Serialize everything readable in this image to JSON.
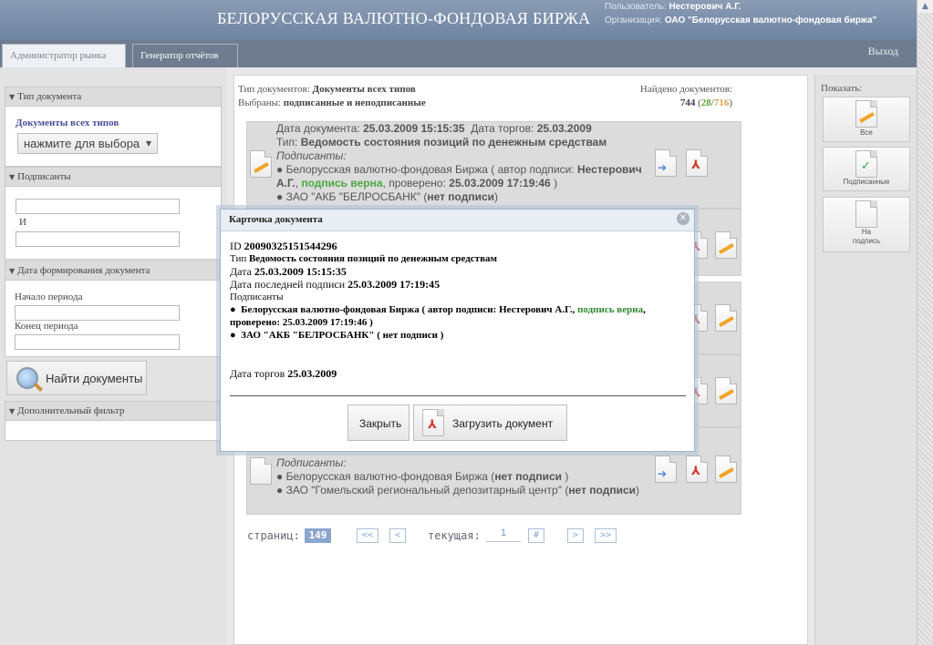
{
  "header": {
    "title": "БЕЛОРУССКАЯ ВАЛЮТНО-ФОНДОВАЯ БИРЖА",
    "user_label": "Пользователь:",
    "user_name": "Нестерович А.Г.",
    "org_label": "Организация:",
    "org_name": "ОАО \"Белорусская валютно-фондовая биржа\""
  },
  "tabs": [
    {
      "label": "Администратор рынка"
    },
    {
      "label": "Генератор отчётов"
    }
  ],
  "logout_label": "Выход",
  "sidebar": {
    "doctype_header": "Тип документа",
    "doctype_value": "Документы всех типов",
    "select_button": "нажмите для выбора",
    "signers_header": "Подписанты",
    "and_label": "И",
    "date_header": "Дата формирования документа",
    "period_start": "Начало периода",
    "period_end": "Конец периода",
    "find_button": "Найти документы",
    "extra_filter_header": "Дополнительный фильтр"
  },
  "filter": {
    "types_label": "Тип документов:",
    "types_value": "Документы всех типов",
    "selected_label": "Выбраны:",
    "selected_value": "подписанные и неподписанные",
    "found_label": "Найдено документов:",
    "found_total": "744",
    "found_signed": "28",
    "found_unsigned": "716",
    "open_paren": "(",
    "slash": "/",
    "close_paren": ")"
  },
  "doc1": {
    "date_label": "Дата документа:",
    "date_value": "25.03.2009 15:15:35",
    "trade_label": "Дата торгов:",
    "trade_value": "25.03.2009",
    "type_label": "Тип:",
    "type_value": "Ведомость состояния позиций по денежным средствам",
    "signers_label": "Подписанты:",
    "signer1_pre": "Белорусская валютно-фондовая Биржа ( автор подписи:",
    "signer1_author": "Нестерович А.Г.",
    "signer1_sep": ",",
    "signer1_status": "подпись верна",
    "signer1_checked": ", проверено:",
    "signer1_time": "25.03.2009 17:19:46",
    "signer1_close": ")",
    "signer2_pre": "ЗАО \"АКБ \"БЕЛРОСБАНК\" (",
    "signer2_status": "нет подписи",
    "signer2_close": ")"
  },
  "doc5": {
    "signers_label": "Подписанты:",
    "signer1_pre": "Белорусская валютно-фондовая Биржа (",
    "signer1_status": "нет подписи",
    "signer1_close": ")",
    "signer2_pre": "ЗАО \"Гомельский региональный депозитарный центр\" (",
    "signer2_status": "нет подписи",
    "signer2_close": ")"
  },
  "pager": {
    "pages_label": "страниц:",
    "total_pages": "149",
    "first": "<<",
    "prev": "<",
    "current_label": "текущая:",
    "current_value": "1",
    "go": "#",
    "next": ">",
    "last": ">>"
  },
  "right_panel": {
    "show_label": "Показать:",
    "all": "Все",
    "signed": "Подписанные",
    "to_sign_line1": "На",
    "to_sign_line2": "подпись"
  },
  "modal": {
    "title": "Карточка документа",
    "id_label": "ID",
    "id_value": "20090325151544296",
    "type_label": "Тип",
    "type_value": "Ведомость состояния позиций по денежным средствам",
    "date_label": "Дата",
    "date_value": "25.03.2009 15:15:35",
    "last_sign_label": "Дата последней подписи",
    "last_sign_value": "25.03.2009 17:19:45",
    "signers_label": "Подписанты",
    "bullet": "●",
    "signer1_pre": "Белорусская валютно-фондовая Биржа ( автор подписи: Нестерович А.Г.,",
    "signer1_status": "подпись верна",
    "signer1_post": ", проверено: 25.03.2009 17:19:46 )",
    "signer2": "ЗАО \"АКБ \"БЕЛРОСБАНК\" ( нет подписи )",
    "trade_label": "Дата торгов",
    "trade_value": "25.03.2009",
    "close_button": "Закрыть",
    "download_button": "Загрузить документ",
    "close_x": "✕"
  }
}
